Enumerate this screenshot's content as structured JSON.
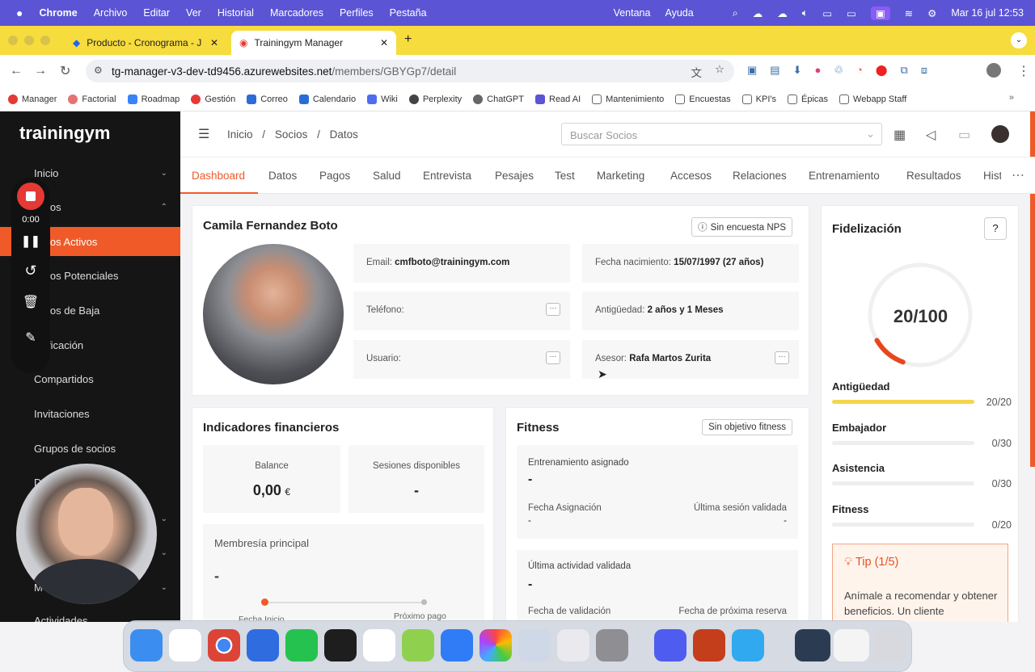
{
  "menubar": {
    "app": "Chrome",
    "items": [
      "Archivo",
      "Editar",
      "Ver",
      "Historial",
      "Marcadores",
      "Perfiles",
      "Pestaña"
    ],
    "right_items": [
      "Ventana",
      "Ayuda"
    ],
    "datetime": "Mar 16 jul 12:53"
  },
  "browser": {
    "tabs": [
      {
        "title": "Producto - Cronograma - J",
        "active": false
      },
      {
        "title": "Trainingym Manager",
        "active": true
      }
    ],
    "url_host": "tg-manager-v3-dev-td9456.azurewebsites.net",
    "url_path": "/members/GBYGp7/detail",
    "bookmarks": [
      "Manager",
      "Factorial",
      "Roadmap",
      "Gestión",
      "Correo",
      "Calendario",
      "Wiki",
      "Perplexity",
      "ChatGPT",
      "Read AI",
      "Mantenimiento",
      "Encuestas",
      "KPI's",
      "Épicas",
      "Webapp Staff"
    ]
  },
  "sidebar": {
    "logo": "trainingym",
    "items": [
      {
        "label": "Inicio",
        "active": false
      },
      {
        "label": "Socios",
        "active": false
      },
      {
        "label": "Socios Activos",
        "active": true
      },
      {
        "label": "Socios Potenciales",
        "active": false
      },
      {
        "label": "Socios de Baja",
        "active": false
      },
      {
        "label": "Fidelización",
        "active": false
      },
      {
        "label": "Compartidos",
        "active": false
      },
      {
        "label": "Invitaciones",
        "active": false
      },
      {
        "label": "Grupos de socios",
        "active": false
      },
      {
        "label": "Actividades",
        "active": false
      }
    ],
    "visible_labels": {
      "inicio": "Inicio",
      "socios": "ios",
      "activos": "ios Activos",
      "potenciales": "ios Potenciales",
      "baja": "ios de Baja",
      "fidel": "ficación",
      "compartidos": "Compartidos",
      "invitaciones": "Invitaciones",
      "grupos": "Grupos de socios",
      "actividades": "Actividades",
      "d": "D",
      "m": "M"
    }
  },
  "recorder": {
    "time": "0:00"
  },
  "header": {
    "breadcrumb": [
      "Inicio",
      "Socios",
      "Datos"
    ],
    "search_placeholder": "Buscar Socios"
  },
  "tabs": [
    "Dashboard",
    "Datos",
    "Pagos",
    "Salud",
    "Entrevista",
    "Pesajes",
    "Test",
    "Marketing",
    "Accesos",
    "Relaciones",
    "Entrenamiento",
    "Resultados",
    "Hist"
  ],
  "profile": {
    "name": "Camila Fernandez Boto",
    "nps_button": "Sin encuesta NPS",
    "email_label": "Email:",
    "email": "cmfboto@trainingym.com",
    "birth_label": "Fecha nacimiento:",
    "birth": "15/07/1997 (27 años)",
    "phone_label": "Teléfono:",
    "seniority_label": "Antigüedad:",
    "seniority": "2 años y 1 Meses",
    "user_label": "Usuario:",
    "advisor_label": "Asesor:",
    "advisor": "Rafa Martos Zurita"
  },
  "financial": {
    "title": "Indicadores financieros",
    "balance_label": "Balance",
    "balance_value": "0,00",
    "currency": "€",
    "sessions_label": "Sesiones disponibles",
    "sessions_value": "-",
    "membership_label": "Membresía principal",
    "membership_value": "-",
    "start_label": "Fecha Inicio",
    "next_payment_label": "Próximo pago"
  },
  "fitness": {
    "title": "Fitness",
    "button": "Sin objetivo fitness",
    "assigned_label": "Entrenamiento asignado",
    "assigned_value": "-",
    "assign_date_label": "Fecha Asignación",
    "assign_date_value": "-",
    "last_session_label": "Última sesión validada",
    "last_session_value": "-",
    "last_activity_label": "Última actividad validada",
    "last_activity_value": "-",
    "validation_date_label": "Fecha de validación",
    "next_booking_label": "Fecha de próxima reserva"
  },
  "loyalty": {
    "title": "Fidelización",
    "score": "20/100",
    "score_fraction": 0.2,
    "metrics": [
      {
        "label": "Antigüedad",
        "value": "20/20",
        "fraction": 1.0
      },
      {
        "label": "Embajador",
        "value": "0/30",
        "fraction": 0
      },
      {
        "label": "Asistencia",
        "value": "0/30",
        "fraction": 0
      },
      {
        "label": "Fitness",
        "value": "0/20",
        "fraction": 0
      }
    ],
    "tip_title": "Tip (1/5)",
    "tip_text": "Anímale a recomendar y obtener beneficios. Un cliente"
  },
  "colors": {
    "accent": "#f05a28",
    "menubar": "#5b54d4",
    "tabbar": "#f6dc3d",
    "sidebar": "#151515"
  }
}
